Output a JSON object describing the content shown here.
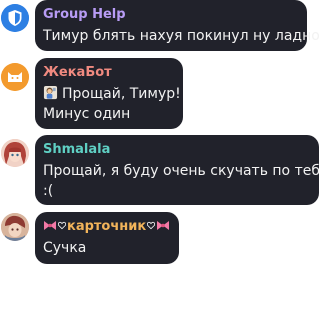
{
  "colors": {
    "bubble_bg": "#21222b",
    "group_help": "#b89cf5",
    "zhekabot": "#f08a80",
    "shmalala": "#5fcfc3",
    "kartochnik": "#f2b45a"
  },
  "messages": [
    {
      "sender": "Group Help",
      "avatar_icon": "shield-icon",
      "lines": [
        "Тимур блять нахуя покинул ну ладно"
      ]
    },
    {
      "sender": "ЖекаБот",
      "avatar_icon": "cat-face-icon",
      "emoji_icon": "person-bowing-emoji",
      "lines": [
        "Прощай, Тимур!",
        "Минус один"
      ]
    },
    {
      "sender": "Shmalala",
      "avatar_icon": "anime-girl-avatar",
      "lines": [
        "Прощай, я буду очень скучать по тебе",
        ":("
      ]
    },
    {
      "sender": "карточник",
      "sender_decor": [
        "pink-bow-emoji",
        "white-heart-emoji",
        "white-heart-emoji",
        "pink-bow-emoji"
      ],
      "avatar_icon": "anime-character-avatar",
      "lines": [
        "Сучка"
      ]
    }
  ]
}
